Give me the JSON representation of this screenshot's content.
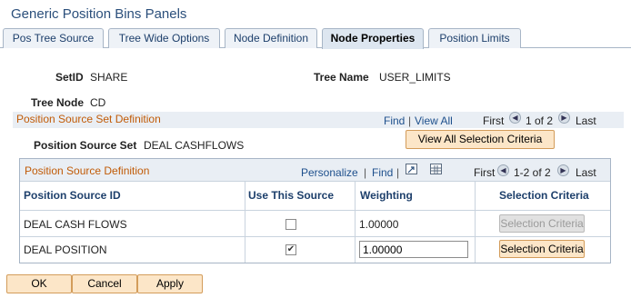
{
  "page": {
    "title": "Generic Position Bins Panels"
  },
  "tabs": [
    {
      "label": "Pos Tree Source"
    },
    {
      "label": "Tree Wide Options"
    },
    {
      "label": "Node Definition"
    },
    {
      "label": "Node Properties"
    },
    {
      "label": "Position Limits"
    }
  ],
  "header": {
    "setid_label": "SetID",
    "setid_value": "SHARE",
    "treename_label": "Tree Name",
    "treename_value": "USER_LIMITS",
    "treenode_label": "Tree Node",
    "treenode_value": "CD"
  },
  "set_section": {
    "title": "Position Source Set Definition",
    "find": "Find",
    "sep": "|",
    "view_all": "View All",
    "first": "First",
    "range": "1 of 2",
    "last": "Last",
    "source_set_label": "Position Source Set",
    "source_set_value": "DEAL CASHFLOWS",
    "view_all_button": "View All Selection Criteria"
  },
  "def_section": {
    "title": "Position Source Definition",
    "personalize": "Personalize",
    "sep": "|",
    "find": "Find",
    "sep2": "|",
    "first": "First",
    "range": "1-2 of 2",
    "last": "Last",
    "columns": [
      "Position Source ID",
      "Use This Source",
      "Weighting",
      "Selection Criteria"
    ],
    "rows": [
      {
        "id": "DEAL CASH FLOWS",
        "use": false,
        "weighting": "1.00000",
        "button": "Selection Criteria"
      },
      {
        "id": "DEAL POSITION",
        "use": true,
        "weighting": "1.00000",
        "button": "Selection Criteria"
      }
    ]
  },
  "footer": {
    "ok": "OK",
    "cancel": "Cancel",
    "apply": "Apply"
  },
  "icons": {
    "prev": "circle-left-arrow-icon",
    "next": "circle-right-arrow-icon",
    "zoom": "zoom-icon",
    "download": "grid-download-icon",
    "checkmark": "checkmark-icon"
  }
}
